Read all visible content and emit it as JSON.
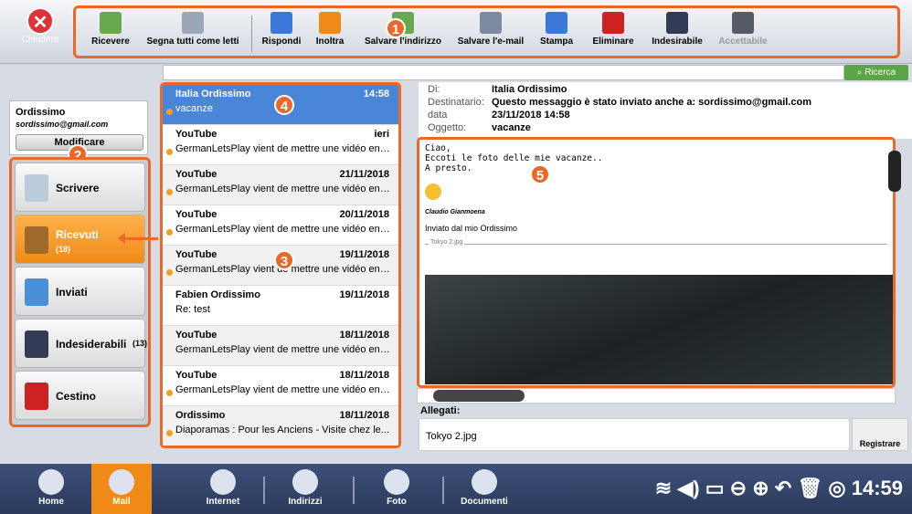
{
  "close_label": "Chiudere",
  "toolbar": [
    {
      "label": "Ricevere",
      "icon": "receive-icon",
      "color": "#6aa84f"
    },
    {
      "label": "Segna tutti come letti",
      "icon": "mark-read-icon",
      "color": "#9aa7b8"
    },
    {
      "label": "Rispondi",
      "icon": "reply-icon",
      "color": "#3c78d8"
    },
    {
      "label": "Inoltra",
      "icon": "forward-icon",
      "color": "#f08a16"
    },
    {
      "label": "Salvare l'indirizzo",
      "icon": "save-address-icon",
      "color": "#6aa84f"
    },
    {
      "label": "Salvare l'e-mail",
      "icon": "save-email-icon",
      "color": "#7a8aa0"
    },
    {
      "label": "Stampa",
      "icon": "print-icon",
      "color": "#3c78d8"
    },
    {
      "label": "Eliminare",
      "icon": "trash-icon",
      "color": "#cc2222"
    },
    {
      "label": "Indesirabile",
      "icon": "junk-icon",
      "color": "#333a55"
    },
    {
      "label": "Accettabile",
      "icon": "accept-icon",
      "color": "#555a66"
    }
  ],
  "account": {
    "name": "Ordissimo",
    "email": "sordissimo@gmail.com",
    "modify": "Modificare"
  },
  "folders": [
    {
      "label": "Scrivere",
      "icon": "compose-icon"
    },
    {
      "label": "Ricevuti",
      "count": "(18)",
      "icon": "inbox-icon"
    },
    {
      "label": "Inviati",
      "icon": "sent-icon"
    },
    {
      "label": "Indesiderabili",
      "count": "(13)",
      "icon": "junk-icon"
    },
    {
      "label": "Cestino",
      "icon": "trash-icon"
    }
  ],
  "search_label": "Ricerca",
  "messages": [
    {
      "from": "Italia Ordissimo",
      "date": "14:58",
      "subject": "vacanze"
    },
    {
      "from": "YouTube",
      "date": "ieri",
      "subject": "GermanLetsPlay vient de mettre une vidéo en l..."
    },
    {
      "from": "YouTube",
      "date": "21/11/2018",
      "subject": "GermanLetsPlay vient de mettre une vidéo en l..."
    },
    {
      "from": "YouTube",
      "date": "20/11/2018",
      "subject": "GermanLetsPlay vient de mettre une vidéo en l..."
    },
    {
      "from": "YouTube",
      "date": "19/11/2018",
      "subject": "GermanLetsPlay vient de mettre une vidéo en l..."
    },
    {
      "from": "Fabien Ordissimo",
      "date": "19/11/2018",
      "subject": "Re: test"
    },
    {
      "from": "YouTube",
      "date": "18/11/2018",
      "subject": "GermanLetsPlay vient de mettre une vidéo en li..."
    },
    {
      "from": "YouTube",
      "date": "18/11/2018",
      "subject": "GermanLetsPlay vient de mettre une vidéo en l..."
    },
    {
      "from": "Ordissimo",
      "date": "18/11/2018",
      "subject": "Diaporamas : Pour les Anciens - Visite chez le..."
    }
  ],
  "header": {
    "from_label": "Di:",
    "from": "Italia Ordissimo",
    "to_label": "Destinatario:",
    "to": "Questo messaggio è stato inviato anche a: sordissimo@gmail.com",
    "date_label": "data",
    "date": "23/11/2018 14:58",
    "subject_label": "Oggetto:",
    "subject": "vacanze"
  },
  "body": {
    "line1": "Ciao,",
    "line2": "Eccoti le foto delle mie vacanze..",
    "line3": "A presto.",
    "signature": "Claudio Gianmoena",
    "sent": "Inviato dal mio Ordissimo",
    "attachment_inline": "Tokyo 2.jpg"
  },
  "attachments": {
    "label": "Allegati:",
    "file": "Tokyo 2.jpg",
    "save": "Registrare"
  },
  "taskbar": [
    {
      "label": "Home"
    },
    {
      "label": "Mail"
    },
    {
      "label": "Internet"
    },
    {
      "label": "Indirizzi"
    },
    {
      "label": "Foto"
    },
    {
      "label": "Documenti"
    }
  ],
  "clock": "14:59",
  "badges": [
    "1",
    "2",
    "3",
    "4",
    "5"
  ]
}
